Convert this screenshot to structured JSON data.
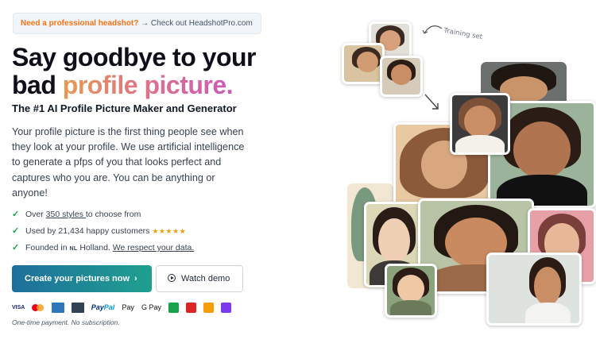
{
  "banner": {
    "highlight": "Need a professional headshot?",
    "rest": "→ Check out HeadshotPro.com"
  },
  "hero": {
    "headline_line1": "Say goodbye to your",
    "headline_line2_plain": "bad ",
    "headline_line2_gradient": "profile picture.",
    "subtitle": "The #1 AI Profile Picture Maker and Generator",
    "description": "Your profile picture is the first thing people see when they look at your profile. We use artificial intelligence to generate a pfps of you that looks perfect and captures who you are. You can be anything or anyone!"
  },
  "features": {
    "styles_prefix": "Over ",
    "styles_link": "350 styles ",
    "styles_suffix": "to choose from",
    "customers": "Used by 21,434 happy customers",
    "stars": "★★★★★",
    "founded_prefix": "Founded in ",
    "country_code": "NL",
    "founded_place": " Holland. ",
    "privacy_link": "We respect your data."
  },
  "cta": {
    "primary_label": "Create your pictures now",
    "primary_chevron": "›",
    "demo_label": "Watch demo"
  },
  "payments": {
    "visa": "VISA",
    "paypal_a": "Pay",
    "paypal_b": "Pal",
    "apple_pay": " Pay",
    "google_pay": "G Pay",
    "icons": [
      "visa-icon",
      "mastercard-icon",
      "amex-icon",
      "card-icon",
      "paypal-icon",
      "apple-pay-icon",
      "google-pay-icon",
      "giropay-icon",
      "przelewy-icon",
      "bancontact-icon",
      "ideal-icon"
    ]
  },
  "note": "One-time payment. No subscription.",
  "collage": {
    "training_label": "Training set",
    "colors": {
      "skin": "#d9a77f",
      "hair_dark": "#2b1d16",
      "hair_light": "#8a5a3b",
      "accent_green": "#9bb39a",
      "bg_beige": "#e7c79a"
    }
  }
}
